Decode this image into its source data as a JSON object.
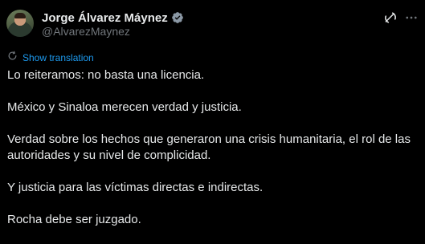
{
  "author": {
    "display_name": "Jorge Álvarez Máynez",
    "handle": "@AlvarezMaynez",
    "verified": true
  },
  "actions": {
    "grok_icon": "grok-icon",
    "more_icon": "more-dots-icon"
  },
  "translation": {
    "label": "Show translation"
  },
  "tweet": {
    "paragraphs": [
      "Lo reiteramos: no basta una licencia.",
      "México y Sinaloa merecen verdad y justicia.",
      "Verdad sobre los hechos que generaron una crisis humanitaria, el rol de las autoridades y su nivel de complicidad.",
      "Y justicia para las víctimas directas e indirectas.",
      "Rocha debe ser juzgado."
    ]
  },
  "colors": {
    "background": "#000000",
    "text": "#e7e9ea",
    "secondary_text": "#71767b",
    "link": "#1d9bf0"
  }
}
